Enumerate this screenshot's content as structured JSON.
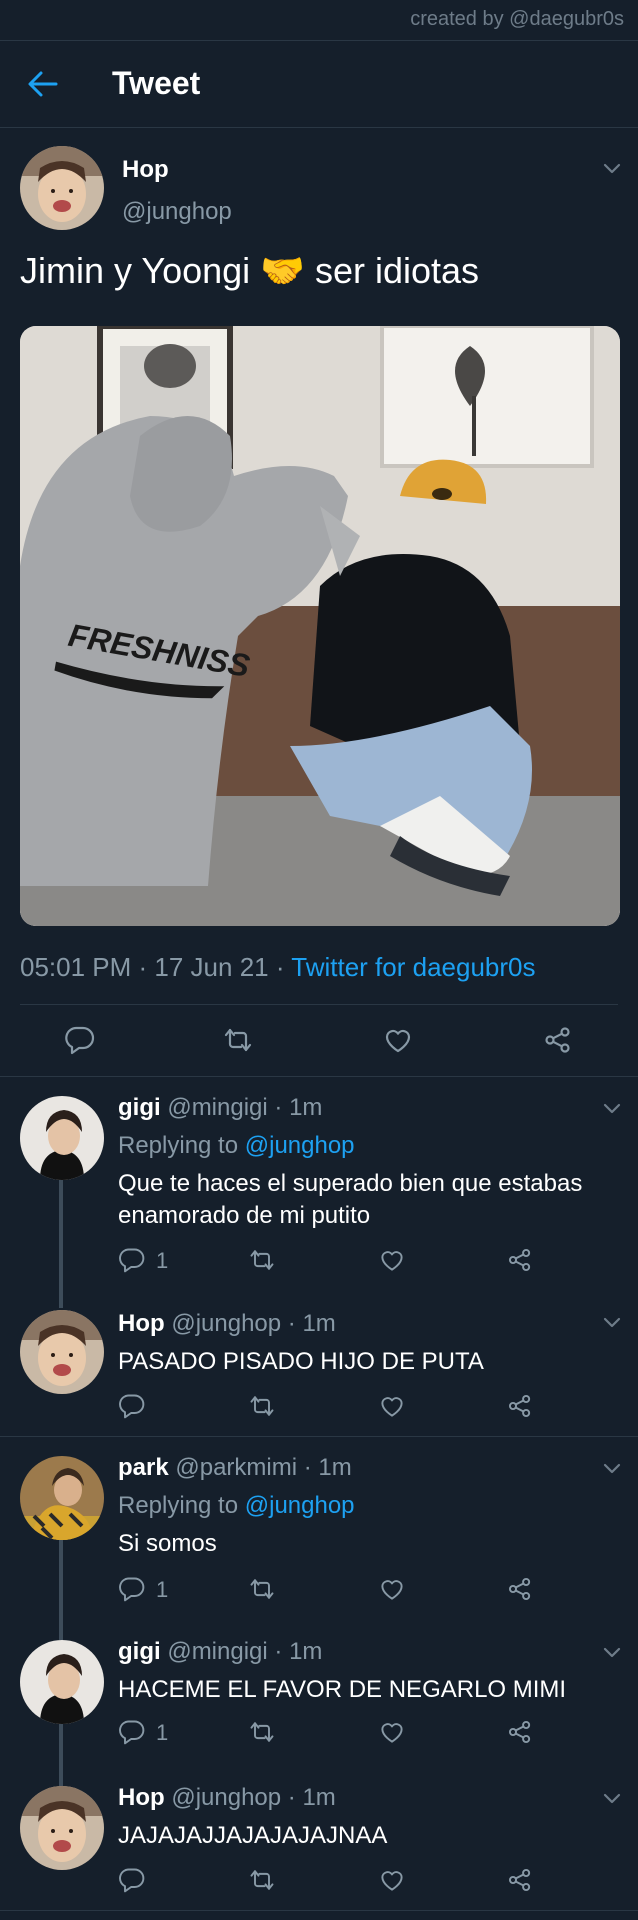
{
  "credit": "created by @daegubr0s",
  "header": {
    "title": "Tweet"
  },
  "tweet": {
    "name": "Hop",
    "handle": "@junghop",
    "text": "Jimin y Yoongi 🤝 ser idiotas",
    "photo_print": "FRESHNISS",
    "time": "05:01 PM",
    "date": "17 Jun 21",
    "source": "Twitter for daegubr0s"
  },
  "replies": [
    {
      "name": "gigi",
      "handle": "@mingigi",
      "ago": "1m",
      "replying_label": "Replying to",
      "replying_to": "@junghop",
      "text": "Que te haces el superado bien que estabas enamorado de mi putito",
      "reply_count": "1"
    },
    {
      "name": "Hop",
      "handle": "@junghop",
      "ago": "1m",
      "text": "PASADO PISADO HIJO DE PUTA"
    },
    {
      "name": "park",
      "handle": "@parkmimi",
      "ago": "1m",
      "replying_label": "Replying to",
      "replying_to": "@junghop",
      "text": "Si somos",
      "reply_count": "1"
    },
    {
      "name": "gigi",
      "handle": "@mingigi",
      "ago": "1m",
      "text": "HACEME EL FAVOR DE NEGARLO MIMI",
      "reply_count": "1"
    },
    {
      "name": "Hop",
      "handle": "@junghop",
      "ago": "1m",
      "text": "JAJAJAJJAJAJAJAJNAA"
    }
  ],
  "icons": {
    "back": "arrow-left-icon",
    "reply": "speech-bubble-icon",
    "retweet": "retweet-icon",
    "like": "heart-icon",
    "share": "share-icon",
    "more": "chevron-down-icon"
  },
  "colors": {
    "background": "#151f2b",
    "accent": "#1da1f2",
    "muted": "#8899a6",
    "divider": "#2a3744"
  }
}
